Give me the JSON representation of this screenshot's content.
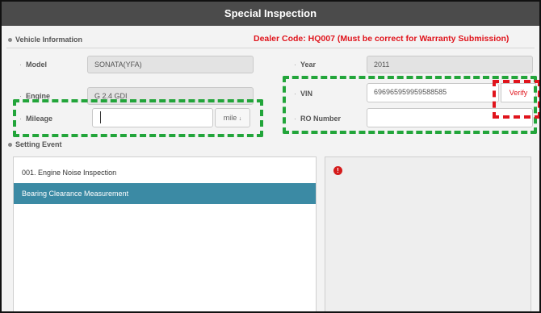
{
  "window": {
    "title": "Special Inspection"
  },
  "vehicle_info": {
    "heading": "Vehicle Information",
    "dealer_notice": "Dealer Code: HQ007  (Must be correct for Warranty Submission)",
    "model": {
      "label": "Model",
      "value": "SONATA(YFA)"
    },
    "engine": {
      "label": "Engine",
      "value": "G 2.4 GDI"
    },
    "mileage": {
      "label": "Mileage",
      "value": "",
      "unit": "mile"
    },
    "year": {
      "label": "Year",
      "value": "2011"
    },
    "vin": {
      "label": "VIN",
      "value": "696965959959588585"
    },
    "verify_label": "Verify",
    "ro_number": {
      "label": "RO Number",
      "value": ""
    }
  },
  "setting_event": {
    "heading": "Setting Event",
    "items": [
      {
        "label": "001. Engine Noise Inspection",
        "selected": false
      },
      {
        "label": "Bearing Clearance Measurement",
        "selected": true
      }
    ]
  },
  "detail_panel": {
    "alert_icon": "exclamation-circle-icon"
  },
  "colors": {
    "title_bar": "#4b4b4b",
    "dealer_text": "#e0141c",
    "selected_row": "#3b8aa4",
    "green_highlight": "#22a53a",
    "red_highlight": "#e0141c"
  }
}
